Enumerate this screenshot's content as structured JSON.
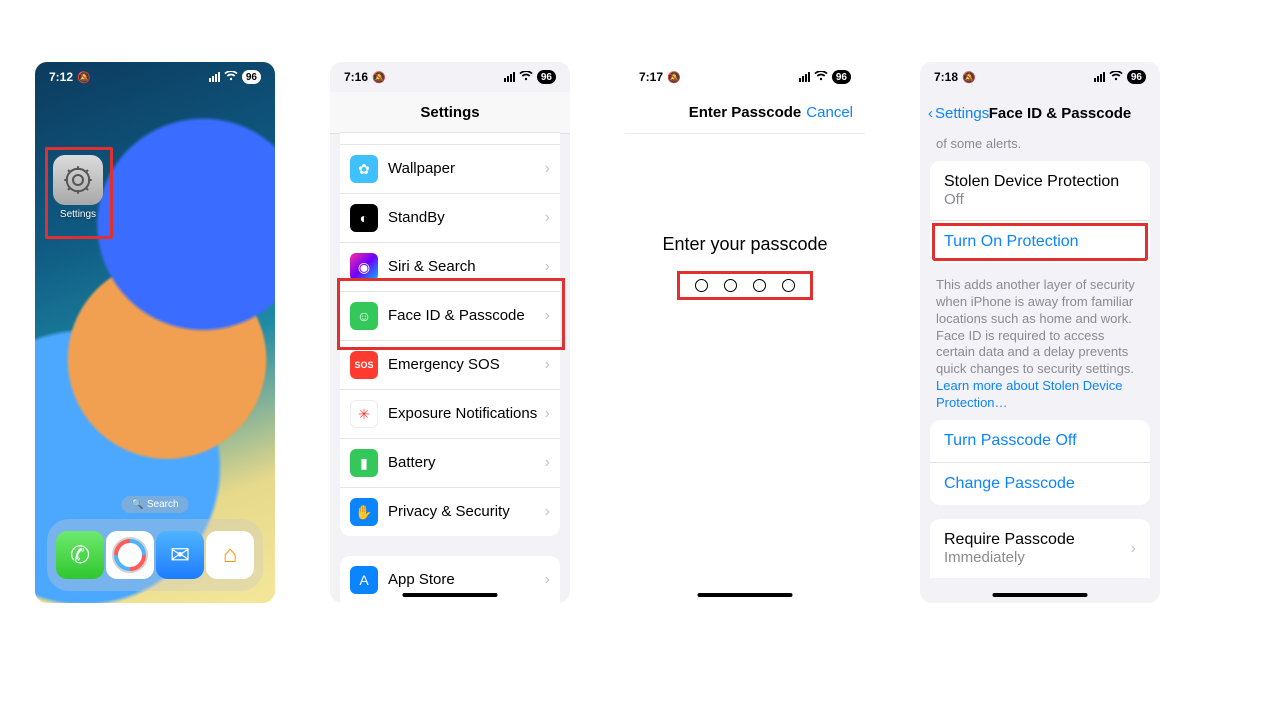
{
  "screen1": {
    "time": "7:12",
    "battery": "96",
    "app_label": "Settings",
    "search_label": "Search"
  },
  "screen2": {
    "time": "7:16",
    "battery": "96",
    "nav_title": "Settings",
    "rows": {
      "wallpaper": "Wallpaper",
      "standby": "StandBy",
      "siri": "Siri & Search",
      "faceid": "Face ID & Passcode",
      "sos": "Emergency SOS",
      "exposure": "Exposure Notifications",
      "battery": "Battery",
      "privacy": "Privacy & Security",
      "appstore": "App Store"
    }
  },
  "screen3": {
    "time": "7:17",
    "battery": "96",
    "nav_title": "Enter Passcode",
    "cancel": "Cancel",
    "prompt": "Enter your passcode"
  },
  "screen4": {
    "time": "7:18",
    "battery": "96",
    "back_label": "Settings",
    "nav_title": "Face ID & Passcode",
    "tail_note": "of some alerts.",
    "sdp_title": "Stolen Device Protection",
    "sdp_status": "Off",
    "turn_on": "Turn On Protection",
    "sdp_note_main": "This adds another layer of security when iPhone is away from familiar locations such as home and work. Face ID is required to access certain data and a delay prevents quick changes to security settings. ",
    "sdp_note_link": "Learn more about Stolen Device Protection…",
    "turn_off_pass": "Turn Passcode Off",
    "change_pass": "Change Passcode",
    "require_label": "Require Passcode",
    "require_value": "Immediately"
  }
}
